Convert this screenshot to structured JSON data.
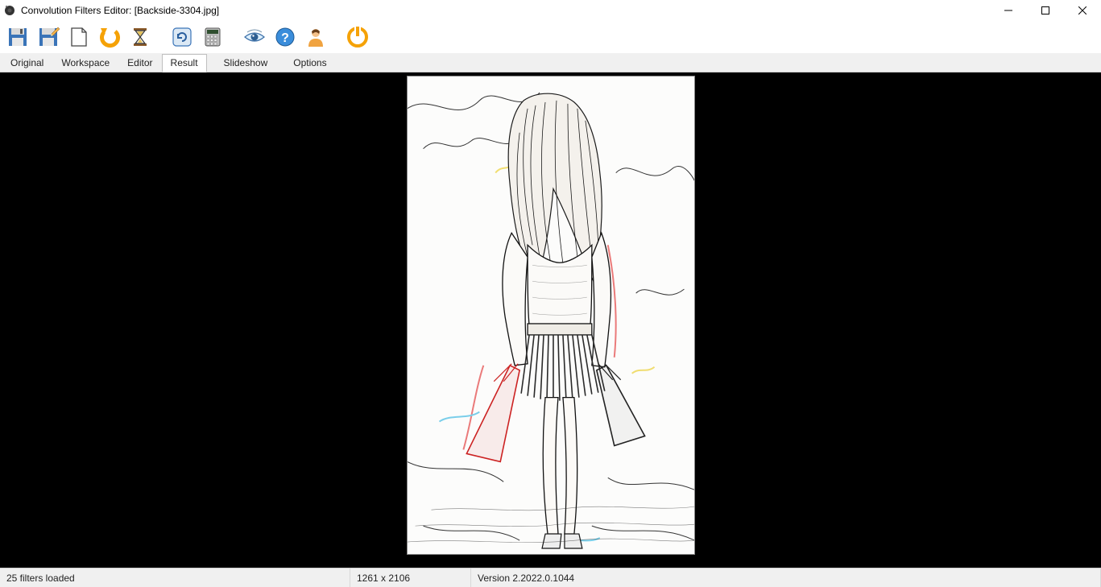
{
  "window": {
    "title": "Convolution Filters Editor: [Backside-3304.jpg]"
  },
  "toolbar": {
    "icons": [
      "save-icon",
      "save-as-icon",
      "new-page-icon",
      "undo-icon",
      "hourglass-icon",
      "refresh-icon",
      "calculator-icon",
      "eye-icon",
      "help-icon",
      "user-icon",
      "power-icon"
    ]
  },
  "tabs": {
    "items": [
      "Original",
      "Workspace",
      "Editor",
      "Result",
      "Slideshow",
      "Options"
    ],
    "active_index": 3
  },
  "status": {
    "filters_loaded": "25 filters loaded",
    "dimensions": "1261 x 2106",
    "version": "Version 2.2022.0.1044"
  },
  "image": {
    "filename": "Backside-3304.jpg",
    "description": "Edge-detected sketch render of a woman walking away carrying shopping bags."
  }
}
